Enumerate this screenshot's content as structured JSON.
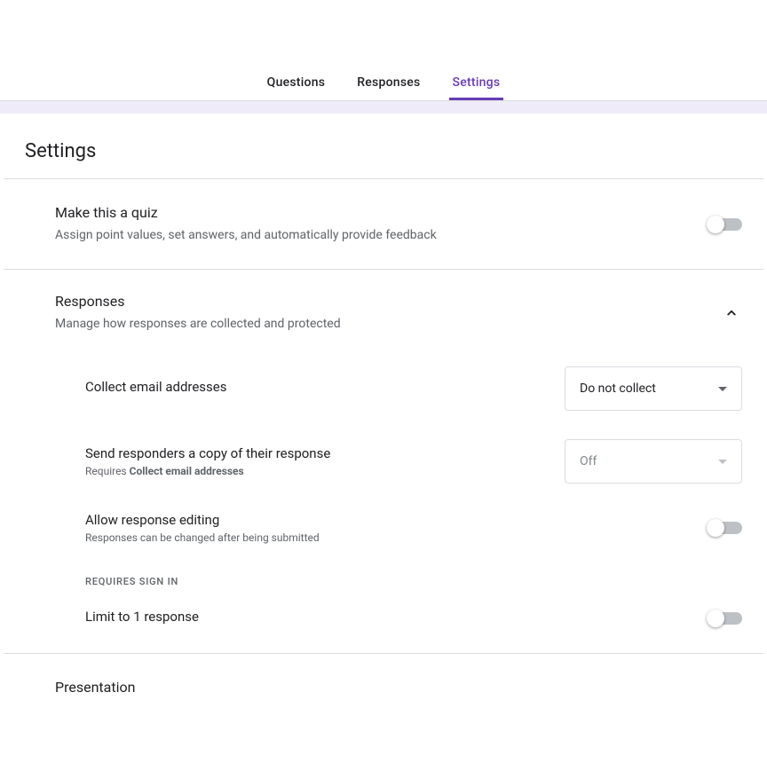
{
  "tabs": {
    "questions": "Questions",
    "responses": "Responses",
    "settings": "Settings"
  },
  "pageTitle": "Settings",
  "quiz": {
    "title": "Make this a quiz",
    "desc": "Assign point values, set answers, and automatically provide feedback"
  },
  "responses": {
    "title": "Responses",
    "desc": "Manage how responses are collected and protected",
    "collectEmail": {
      "title": "Collect email addresses",
      "selected": "Do not collect"
    },
    "sendCopy": {
      "title": "Send responders a copy of their response",
      "descPrefix": "Requires ",
      "descBold": "Collect email addresses",
      "selected": "Off"
    },
    "allowEdit": {
      "title": "Allow response editing",
      "desc": "Responses can be changed after being submitted"
    },
    "requiresSignIn": "REQUIRES SIGN IN",
    "limitOne": {
      "title": "Limit to 1 response"
    }
  },
  "presentation": {
    "title": "Presentation"
  }
}
